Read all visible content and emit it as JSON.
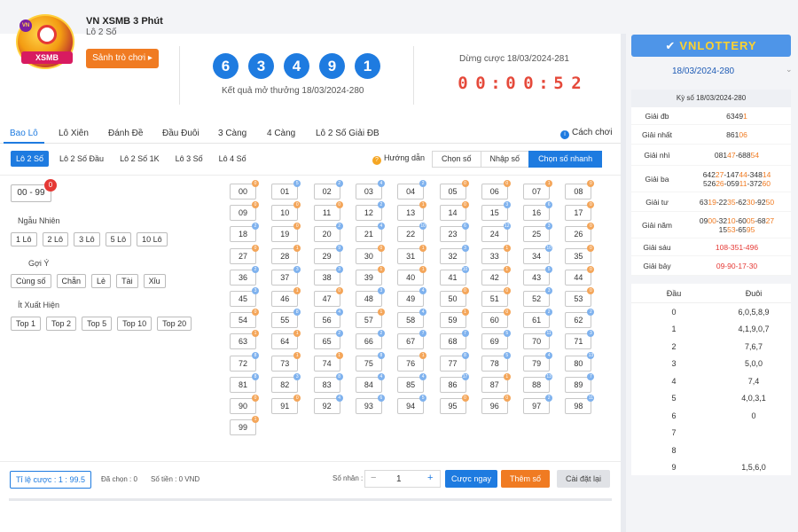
{
  "game": {
    "title": "VN XSMB 3 Phút",
    "subtitle": "Lô 2 Số",
    "play_button": "Sảnh trò chơi ▸",
    "logo_text": "XSMB",
    "logo_badge": "VN"
  },
  "result": {
    "balls": [
      "6",
      "3",
      "4",
      "9",
      "1"
    ],
    "caption": "Kết quả mở thưởng 18/03/2024-280",
    "ball_color": "#1e7be0"
  },
  "countdown": {
    "caption": "Dừng cược 18/03/2024-281",
    "digits": [
      "0",
      "0",
      ":",
      "0",
      "0",
      ":",
      "5",
      "2"
    ],
    "color": "#e5493a"
  },
  "tabs": [
    "Bao Lô",
    "Lô Xiên",
    "Đánh Đề",
    "Đầu Đuôi",
    "3 Càng",
    "4 Càng",
    "Lô 2 Số Giải ĐB"
  ],
  "how_to_play": "Cách chơi",
  "subtabs": [
    "Lô 2 Số",
    "Lô 2 Số Đầu",
    "Lô 2 Số 1K",
    "Lô 3 Số",
    "Lô 4 Số"
  ],
  "guide": "Hướng dẫn",
  "modes": [
    "Chọn số",
    "Nhập số",
    "Chọn số nhanh"
  ],
  "filters": {
    "range": "00 - 99",
    "range_badge": "0",
    "random_label": "Ngẫu Nhiên",
    "random": [
      "1 Lô",
      "2 Lô",
      "3 Lô",
      "5 Lô",
      "10 Lô"
    ],
    "suggest_label": "Gợi Ý",
    "suggest": [
      "Cùng số",
      "Chẵn",
      "Lẻ",
      "Tài",
      "Xỉu"
    ],
    "rare_label": "Ít Xuất Hiện",
    "rare": [
      "Top 1",
      "Top 2",
      "Top 5",
      "Top 10",
      "Top 20"
    ]
  },
  "numbers": [
    [
      "00",
      "0",
      "o"
    ],
    [
      "01",
      "5",
      "b"
    ],
    [
      "02",
      "2",
      "b"
    ],
    [
      "03",
      "4",
      "b"
    ],
    [
      "04",
      "2",
      "b"
    ],
    [
      "05",
      "0",
      "o"
    ],
    [
      "06",
      "0",
      "o"
    ],
    [
      "07",
      "1",
      "o"
    ],
    [
      "08",
      "0",
      "o"
    ],
    [
      "09",
      "0",
      "o"
    ],
    [
      "10",
      "0",
      "o"
    ],
    [
      "11",
      "0",
      "o"
    ],
    [
      "12",
      "2",
      "b"
    ],
    [
      "13",
      "1",
      "o"
    ],
    [
      "14",
      "0",
      "o"
    ],
    [
      "15",
      "3",
      "b"
    ],
    [
      "16",
      "6",
      "b"
    ],
    [
      "17",
      "0",
      "o"
    ],
    [
      "18",
      "2",
      "b"
    ],
    [
      "19",
      "0",
      "o"
    ],
    [
      "20",
      "2",
      "b"
    ],
    [
      "21",
      "4",
      "b"
    ],
    [
      "22",
      "10",
      "b"
    ],
    [
      "23",
      "6",
      "b"
    ],
    [
      "24",
      "12",
      "b"
    ],
    [
      "25",
      "3",
      "b"
    ],
    [
      "26",
      "0",
      "o"
    ],
    [
      "27",
      "0",
      "o"
    ],
    [
      "28",
      "1",
      "o"
    ],
    [
      "29",
      "9",
      "b"
    ],
    [
      "30",
      "0",
      "o"
    ],
    [
      "31",
      "1",
      "o"
    ],
    [
      "32",
      "3",
      "b"
    ],
    [
      "33",
      "1",
      "o"
    ],
    [
      "34",
      "10",
      "b"
    ],
    [
      "35",
      "0",
      "o"
    ],
    [
      "36",
      "2",
      "b"
    ],
    [
      "37",
      "3",
      "b"
    ],
    [
      "38",
      "3",
      "b"
    ],
    [
      "39",
      "1",
      "o"
    ],
    [
      "40",
      "1",
      "o"
    ],
    [
      "41",
      "10",
      "b"
    ],
    [
      "42",
      "1",
      "o"
    ],
    [
      "43",
      "5",
      "b"
    ],
    [
      "44",
      "0",
      "o"
    ],
    [
      "45",
      "3",
      "b"
    ],
    [
      "46",
      "1",
      "o"
    ],
    [
      "47",
      "0",
      "o"
    ],
    [
      "48",
      "3",
      "b"
    ],
    [
      "49",
      "4",
      "b"
    ],
    [
      "50",
      "0",
      "o"
    ],
    [
      "51",
      "0",
      "o"
    ],
    [
      "52",
      "3",
      "b"
    ],
    [
      "53",
      "0",
      "o"
    ],
    [
      "54",
      "0",
      "o"
    ],
    [
      "55",
      "8",
      "b"
    ],
    [
      "56",
      "4",
      "b"
    ],
    [
      "57",
      "1",
      "o"
    ],
    [
      "58",
      "4",
      "b"
    ],
    [
      "59",
      "1",
      "o"
    ],
    [
      "60",
      "0",
      "o"
    ],
    [
      "61",
      "2",
      "b"
    ],
    [
      "62",
      "2",
      "b"
    ],
    [
      "63",
      "1",
      "o"
    ],
    [
      "64",
      "1",
      "o"
    ],
    [
      "65",
      "2",
      "b"
    ],
    [
      "66",
      "2",
      "b"
    ],
    [
      "67",
      "7",
      "b"
    ],
    [
      "68",
      "7",
      "b"
    ],
    [
      "69",
      "5",
      "b"
    ],
    [
      "70",
      "11",
      "b"
    ],
    [
      "71",
      "3",
      "b"
    ],
    [
      "72",
      "8",
      "b"
    ],
    [
      "73",
      "1",
      "o"
    ],
    [
      "74",
      "1",
      "o"
    ],
    [
      "75",
      "8",
      "b"
    ],
    [
      "76",
      "1",
      "o"
    ],
    [
      "77",
      "8",
      "b"
    ],
    [
      "78",
      "5",
      "b"
    ],
    [
      "79",
      "4",
      "b"
    ],
    [
      "80",
      "13",
      "b"
    ],
    [
      "81",
      "8",
      "b"
    ],
    [
      "82",
      "3",
      "b"
    ],
    [
      "83",
      "8",
      "b"
    ],
    [
      "84",
      "4",
      "b"
    ],
    [
      "85",
      "4",
      "b"
    ],
    [
      "86",
      "17",
      "b"
    ],
    [
      "87",
      "1",
      "o"
    ],
    [
      "88",
      "13",
      "b"
    ],
    [
      "89",
      "7",
      "b"
    ],
    [
      "90",
      "0",
      "o"
    ],
    [
      "91",
      "0",
      "o"
    ],
    [
      "92",
      "4",
      "b"
    ],
    [
      "93",
      "6",
      "b"
    ],
    [
      "94",
      "5",
      "b"
    ],
    [
      "95",
      "0",
      "o"
    ],
    [
      "96",
      "0",
      "o"
    ],
    [
      "97",
      "2",
      "b"
    ],
    [
      "98",
      "11",
      "b"
    ],
    [
      "99",
      "1",
      "o"
    ]
  ],
  "footer": {
    "rate": "Tỉ lệ cược : 1 : 99.5",
    "selected": "Đã chọn : 0",
    "amount": "Số tiền : 0 VND",
    "multiplier_label": "Số nhân :",
    "multiplier_value": "1",
    "minus": "−",
    "plus": "+",
    "bet_now": "Cược ngay",
    "add_number": "Thêm số",
    "reset": "Cài đặt lại"
  },
  "right": {
    "brand": "VNLOTTERY",
    "date": "18/03/2024-280",
    "kyso": "Kỳ số 18/03/2024-280",
    "results": [
      {
        "label": "Giải đb",
        "lines": [
          [
            [
              "6349",
              ""
            ],
            [
              "1",
              "hl"
            ]
          ]
        ],
        "red": false
      },
      {
        "label": "Giải nhất",
        "lines": [
          [
            [
              "861",
              ""
            ],
            [
              "06",
              "hl"
            ]
          ]
        ],
        "red": false
      },
      {
        "label": "Giải nhì",
        "lines": [
          [
            [
              "081",
              ""
            ],
            [
              "47",
              "hl"
            ],
            [
              "-688",
              ""
            ],
            [
              "54",
              "hl"
            ]
          ]
        ],
        "red": false
      },
      {
        "label": "Giải ba",
        "lines": [
          [
            [
              "642",
              ""
            ],
            [
              "27",
              "hl"
            ],
            [
              "-147",
              ""
            ],
            [
              "44",
              "hl"
            ],
            [
              "-348",
              ""
            ],
            [
              "14",
              "hl"
            ]
          ],
          [
            [
              "526",
              ""
            ],
            [
              "26",
              "hl"
            ],
            [
              "-059",
              ""
            ],
            [
              "11",
              "hl"
            ],
            [
              "-372",
              ""
            ],
            [
              "60",
              "hl"
            ]
          ]
        ],
        "red": false
      },
      {
        "label": "Giải tư",
        "lines": [
          [
            [
              "63",
              ""
            ],
            [
              "19",
              "hl"
            ],
            [
              "-22",
              ""
            ],
            [
              "35",
              "hl"
            ],
            [
              "-62",
              ""
            ],
            [
              "30",
              "hl"
            ],
            [
              "-92",
              ""
            ],
            [
              "50",
              "hl"
            ]
          ]
        ],
        "red": false
      },
      {
        "label": "Giải năm",
        "lines": [
          [
            [
              "09",
              ""
            ],
            [
              "00",
              "hl"
            ],
            [
              "-32",
              ""
            ],
            [
              "10",
              "hl"
            ],
            [
              "-60",
              ""
            ],
            [
              "05",
              "hl"
            ],
            [
              "-68",
              ""
            ],
            [
              "27",
              "hl"
            ]
          ],
          [
            [
              "15",
              ""
            ],
            [
              "53",
              "hl"
            ],
            [
              "-65",
              ""
            ],
            [
              "95",
              "hl"
            ]
          ]
        ],
        "red": false
      },
      {
        "label": "Giải sáu",
        "lines": [
          [
            [
              "108-351-496",
              ""
            ]
          ]
        ],
        "red": true
      },
      {
        "label": "Giải bảy",
        "lines": [
          [
            [
              "09-90-17-30",
              ""
            ]
          ]
        ],
        "red": true
      }
    ],
    "head_col": "Đầu",
    "tail_col": "Đuôi",
    "head_tail": [
      [
        "0",
        "6,0,5,8,9"
      ],
      [
        "1",
        "4,1,9,0,7"
      ],
      [
        "2",
        "7,6,7"
      ],
      [
        "3",
        "5,0,0"
      ],
      [
        "4",
        "7,4"
      ],
      [
        "5",
        "4,0,3,1"
      ],
      [
        "6",
        "0"
      ],
      [
        "7",
        ""
      ],
      [
        "8",
        ""
      ],
      [
        "9",
        "1,5,6,0"
      ]
    ]
  }
}
